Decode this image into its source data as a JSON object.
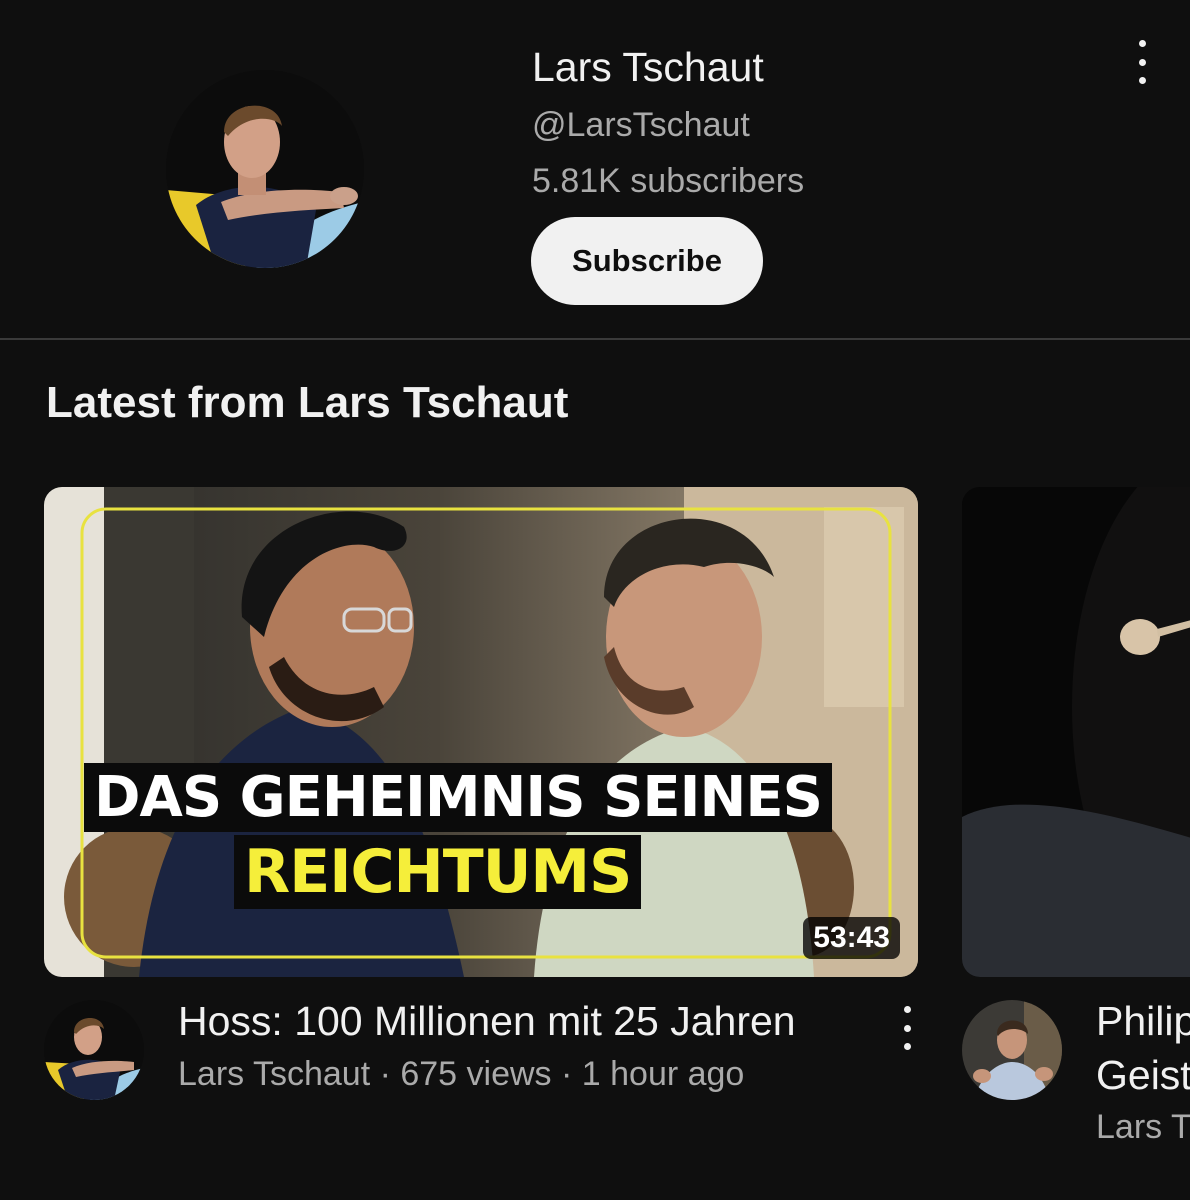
{
  "channel": {
    "name": "Lars Tschaut",
    "handle": "@LarsTschaut",
    "subscribers": "5.81K subscribers",
    "subscribe_label": "Subscribe"
  },
  "section": {
    "title": "Latest from Lars Tschaut"
  },
  "videos": [
    {
      "thumbnail_line1": "DAS GEHEIMNIS SEINES",
      "thumbnail_line2": "REICHTUMS",
      "duration": "53:43",
      "title": "Hoss: 100 Millionen mit 25 Jahren",
      "channel": "Lars Tschaut",
      "views": "675 views",
      "age": "1 hour ago",
      "meta": "Lars Tschaut · 675 views · 1 hour ago"
    },
    {
      "title_line1": "Philip",
      "title_line2": "Geist",
      "meta": "Lars T"
    }
  ],
  "colors": {
    "background": "#0f0f0f",
    "text_primary": "#f1f1f1",
    "text_secondary": "#aaaaaa",
    "thumbnail_accent": "#f5ee3a"
  },
  "icons": {
    "channel_menu": "more-vert-icon",
    "video_menu": "more-vert-icon"
  }
}
